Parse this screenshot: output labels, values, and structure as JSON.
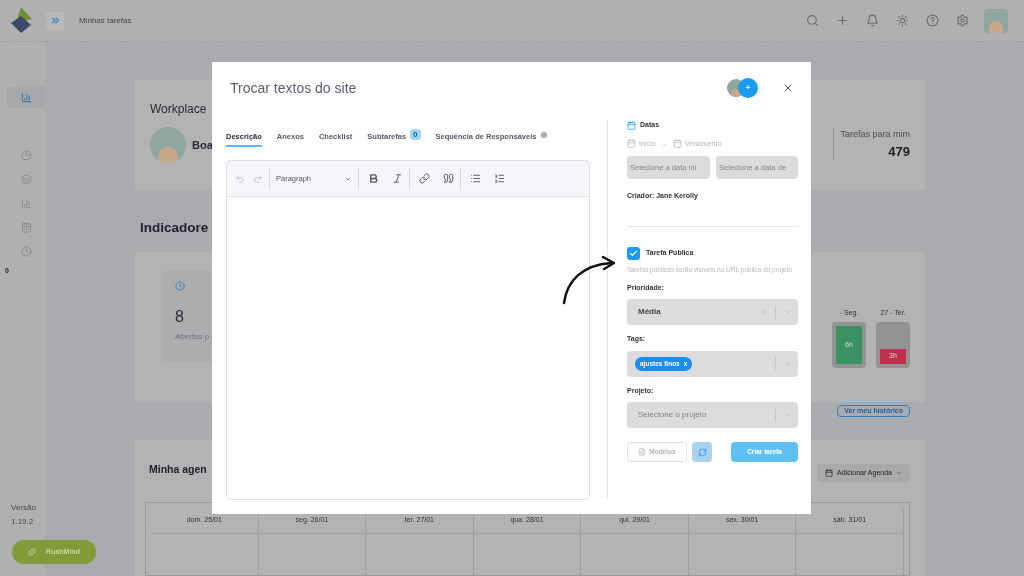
{
  "header": {
    "page_title": "Minhas tarefas"
  },
  "sidebar": {
    "items": [
      {
        "selected": true
      },
      {
        "selected": false
      },
      {
        "selected": false
      },
      {
        "selected": false
      },
      {
        "selected": false
      },
      {
        "selected": false
      }
    ],
    "counter": "0",
    "version_label": "Versão",
    "version": "1.19.2",
    "assistant_button": "RushMind"
  },
  "workplace": {
    "title": "Workplace",
    "greeting": "Boa",
    "stat_label": "Tarefas para mim",
    "stat_value": "479"
  },
  "indicators": {
    "title": "Indicadore",
    "open_count": "8",
    "open_label": "Abertas p",
    "history_button": "Ver meu histórico",
    "days": [
      {
        "label": "- Seg.",
        "hours": "6h",
        "color": "#3a9162",
        "level": 1
      },
      {
        "label": "27 - Ter.",
        "hours": "3h",
        "color": "#c0304f",
        "level": 0.4
      }
    ]
  },
  "agenda": {
    "title": "Minha agen",
    "add_button": "Adicionar Agenda",
    "days": [
      "dom. 25/01",
      "seg. 26/01",
      "ter. 27/01",
      "qua. 28/01",
      "qui. 29/01",
      "sex. 30/01",
      "sáb. 31/01"
    ]
  },
  "modal": {
    "title": "Trocar textos do site",
    "add_member": "+",
    "tabs": [
      {
        "label": "Descrição",
        "selected": true,
        "kind": "plain"
      },
      {
        "label": "Anexos",
        "selected": false,
        "kind": "plain"
      },
      {
        "label": "Checklist",
        "selected": false,
        "kind": "plain"
      },
      {
        "label": "Subtarefas",
        "selected": false,
        "kind": "count",
        "count": "0"
      },
      {
        "label": "Sequência de Responsáveis",
        "selected": false,
        "kind": "info"
      }
    ],
    "editor": {
      "block_format": "Paragraph"
    },
    "dates": {
      "title": "Datas",
      "start_label": "Início",
      "arrow": "→",
      "due_label": "Vencimento",
      "start_placeholder": "Selecione a data ini",
      "due_placeholder": "Selecione a data de"
    },
    "creator": "Criador: Jane Kerolly",
    "public_task": {
      "label": "Tarefa Pública",
      "checked": true,
      "help": "Tarefas públicas serão visíveis na URL pública do projeto"
    },
    "priority": {
      "label": "Prioridade:",
      "value": "Média"
    },
    "tags": {
      "label": "Tags:",
      "items": [
        {
          "label": "ajustes finos",
          "remove": "x"
        }
      ]
    },
    "project": {
      "label": "Projeto:",
      "placeholder": "Selecione o projeto"
    },
    "buttons": {
      "templates": "Modelos",
      "create": "Criar tarefa"
    }
  }
}
